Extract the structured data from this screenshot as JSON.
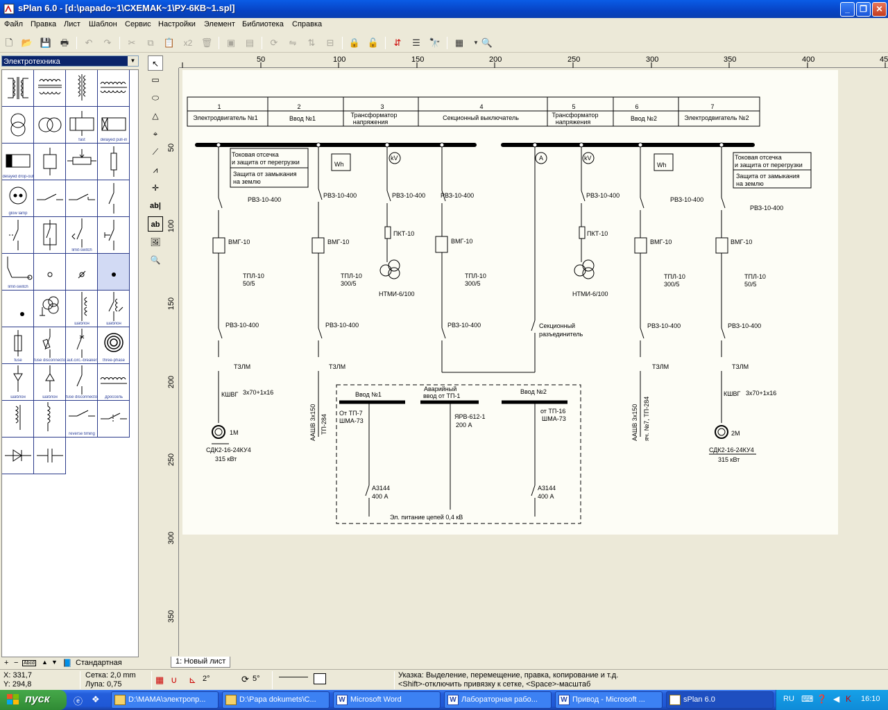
{
  "window": {
    "title": "sPlan 6.0 - [d:\\papado~1\\СХЕМАК~1\\РУ-6КВ~1.spl]",
    "minimize": "_",
    "maximize": "❐",
    "close": "✕"
  },
  "menu": [
    "Файл",
    "Правка",
    "Лист",
    "Шаблон",
    "Сервис",
    "Настройки",
    "Элемент",
    "Библиотека",
    "Справка"
  ],
  "toolbar": {
    "copies_label": "x2"
  },
  "library": {
    "category": "Электротехника",
    "captions": {
      "fast": "fast",
      "delayed_pull_in": "delayed pull-in",
      "delayed_drop_out": "delayed drop-out",
      "glow_lamp": "glow lamp",
      "limit_switch": "limit-switch",
      "limit_switch2": "limit-switch",
      "shablon": "шаблон",
      "fuse": "fuse",
      "fuse_disconnector": "fuse disconnector",
      "autocircuit_breaker": "aut.circ.-breaker",
      "three_phase": "three-phase",
      "fuse_disconnector2": "fuse disconnector",
      "drossel": "дроссель",
      "reverse_timing": "reverse timing"
    },
    "footer": {
      "add": "+",
      "remove": "−",
      "abcd": "Abcd",
      "up": "▲",
      "down": "▼",
      "set_name": "Стандартная"
    }
  },
  "rulers": {
    "top": [
      "50",
      "100",
      "150",
      "200",
      "250",
      "300",
      "350",
      "400",
      "45"
    ],
    "left": [
      "50",
      "100",
      "150",
      "200",
      "250",
      "300",
      "350"
    ]
  },
  "schematic": {
    "header_numbers": [
      "1",
      "2",
      "3",
      "4",
      "5",
      "6",
      "7"
    ],
    "header_labels": [
      "Электродвигатель №1",
      "Ввод №1",
      "Трансформатор",
      "Секционный выключатель",
      "Трансформатор",
      "Ввод №2",
      "Электродвигатель №2"
    ],
    "header_labels2": [
      "",
      "",
      "напряжения",
      "",
      "напряжения",
      "",
      ""
    ],
    "prot1": [
      "Токовая отсечка",
      "и защита от перегрузки"
    ],
    "prot2": [
      "Защита от замыкания",
      "на землю"
    ],
    "rvz": "РВЗ-10-400",
    "vmg": "ВМГ-10",
    "tpl": "ТПЛ-10",
    "ratio_50": "50/5",
    "ratio_300": "300/5",
    "pkt": "ПКТ-10",
    "ntmi": "НТМИ-6/100",
    "wh": "Wh",
    "kv": "kV",
    "amp": "A",
    "tzlm": "ТЗЛМ",
    "kshvg": "КШВГ",
    "cable_m": "3х70+1х16",
    "aashv": "ААШВ 3х150",
    "tp284": "ТП-284",
    "tp284b": "яч. №7,  ТП-284",
    "motor1": "1М",
    "motor2": "2М",
    "sdk": "СДК2-16-24КУ4",
    "power": "315 кВт",
    "sect_disc": [
      "Секционный",
      "разъединитель"
    ],
    "vvod1": "Ввод №1",
    "vvod2": "Ввод №2",
    "avar": [
      "Аварийный",
      "ввод от ТП-1"
    ],
    "ot_tp7": "От ТП-7",
    "sha73": "ШМА-73",
    "yarv": "ЯРВ-612-1",
    "a200": "200 А",
    "ot_tp16": "от  ТП-16",
    "a3144": "А3144",
    "a400": "400 А",
    "el_pit": "Эл. питание цепей 0,4 кВ"
  },
  "sheet_tab": "1: Новый лист",
  "status": {
    "x": "X: 331,7",
    "y": "Y: 294,8",
    "grid": "Сетка:  2,0 mm",
    "zoom": "Лупа:   0,75",
    "angle1": "2°",
    "angle2": "5°",
    "hint1": "Указка: Выделение, перемещение, правка, копирование и т.д.",
    "hint2": "<Shift>-отключить привязку к сетке, <Space>-масштаб"
  },
  "taskbar": {
    "start": "пуск",
    "tasks": [
      "D:\\MAMA\\электропр...",
      "D:\\Papa dokumets\\С...",
      "Microsoft Word",
      "Лабораторная рабо...",
      "Привод - Microsoft ...",
      "sPlan 6.0"
    ],
    "lang": "RU",
    "time": "16:10"
  },
  "colors": {
    "title_bar": "#0a5ce6",
    "taskbar": "#245edb",
    "start_button": "#3c9a3f",
    "library_grid_lines": "#2a3a8a",
    "sheet": "#fdfdf6"
  }
}
